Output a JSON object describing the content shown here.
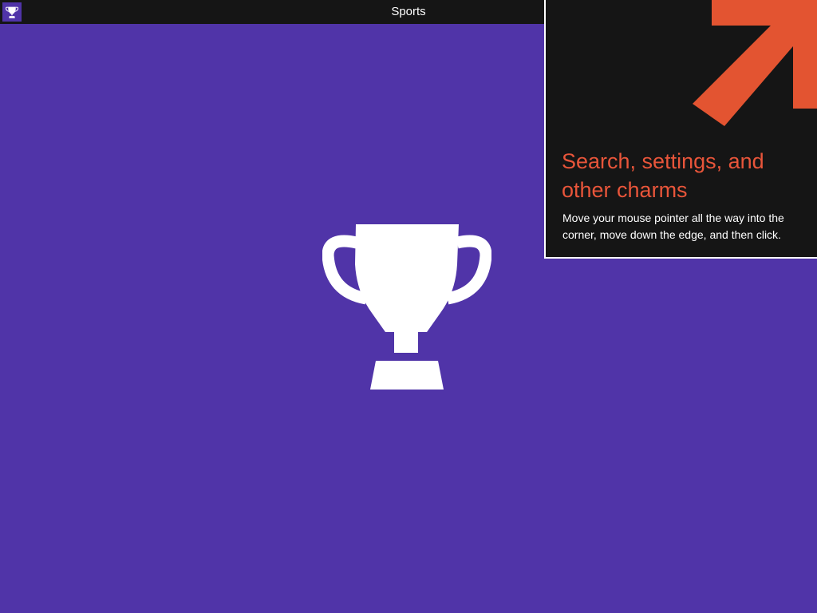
{
  "app": {
    "title": "Sports",
    "icon": "trophy-icon",
    "background_color": "#5034a8",
    "titlebar_color": "#151515"
  },
  "splash": {
    "icon": "trophy-icon",
    "icon_color": "#ffffff"
  },
  "tip": {
    "heading": "Search, settings, and other charms",
    "body": "Move your mouse pointer all the way into the corner, move down the edge, and then click.",
    "heading_color": "#e8553a",
    "arrow_icon": "arrow-up-right-icon",
    "arrow_color": "#e35431",
    "panel_color": "#151515"
  }
}
